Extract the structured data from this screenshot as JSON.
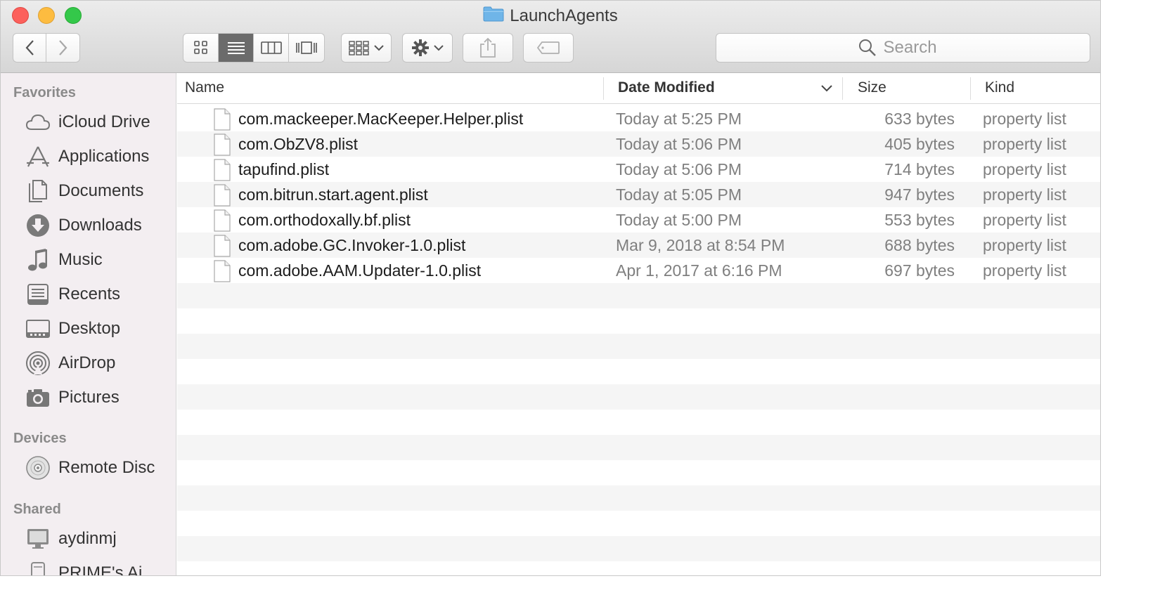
{
  "window": {
    "title": "LaunchAgents"
  },
  "toolbar": {
    "back_icon": "chevron-left-icon",
    "forward_icon": "chevron-right-icon",
    "view_modes": [
      "icon-view",
      "list-view",
      "column-view",
      "cover-flow-view"
    ],
    "active_view": "list-view",
    "search_placeholder": "Search"
  },
  "sidebar": {
    "favorites_heading": "Favorites",
    "favorites": [
      {
        "label": "iCloud Drive",
        "icon": "cloud-icon"
      },
      {
        "label": "Applications",
        "icon": "applications-icon"
      },
      {
        "label": "Documents",
        "icon": "documents-icon"
      },
      {
        "label": "Downloads",
        "icon": "downloads-icon"
      },
      {
        "label": "Music",
        "icon": "music-icon"
      },
      {
        "label": "Recents",
        "icon": "recents-icon"
      },
      {
        "label": "Desktop",
        "icon": "desktop-icon"
      },
      {
        "label": "AirDrop",
        "icon": "airdrop-icon"
      },
      {
        "label": "Pictures",
        "icon": "camera-icon"
      }
    ],
    "devices_heading": "Devices",
    "devices": [
      {
        "label": "Remote Disc",
        "icon": "disc-icon"
      }
    ],
    "shared_heading": "Shared",
    "shared": [
      {
        "label": "aydinmj",
        "icon": "monitor-icon"
      },
      {
        "label": "PRIME's Ai",
        "icon": "mac-tower-icon"
      }
    ]
  },
  "columns": {
    "name": "Name",
    "date": "Date Modified",
    "size": "Size",
    "kind": "Kind"
  },
  "files": [
    {
      "name": "com.mackeeper.MacKeeper.Helper.plist",
      "date": "Today at 5:25 PM",
      "size": "633 bytes",
      "kind": "property list"
    },
    {
      "name": "com.ObZV8.plist",
      "date": "Today at 5:06 PM",
      "size": "405 bytes",
      "kind": "property list"
    },
    {
      "name": "tapufind.plist",
      "date": "Today at 5:06 PM",
      "size": "714 bytes",
      "kind": "property list"
    },
    {
      "name": "com.bitrun.start.agent.plist",
      "date": "Today at 5:05 PM",
      "size": "947 bytes",
      "kind": "property list"
    },
    {
      "name": "com.orthodoxally.bf.plist",
      "date": "Today at 5:00 PM",
      "size": "553 bytes",
      "kind": "property list"
    },
    {
      "name": "com.adobe.GC.Invoker-1.0.plist",
      "date": "Mar 9, 2018 at 8:54 PM",
      "size": "688 bytes",
      "kind": "property list"
    },
    {
      "name": "com.adobe.AAM.Updater-1.0.plist",
      "date": "Apr 1, 2017 at 6:16 PM",
      "size": "697 bytes",
      "kind": "property list"
    }
  ],
  "colors": {
    "sidebar_bg": "#f3eef1",
    "alt_row": "#f5f5f5",
    "folder_blue": "#6fb5e8"
  }
}
